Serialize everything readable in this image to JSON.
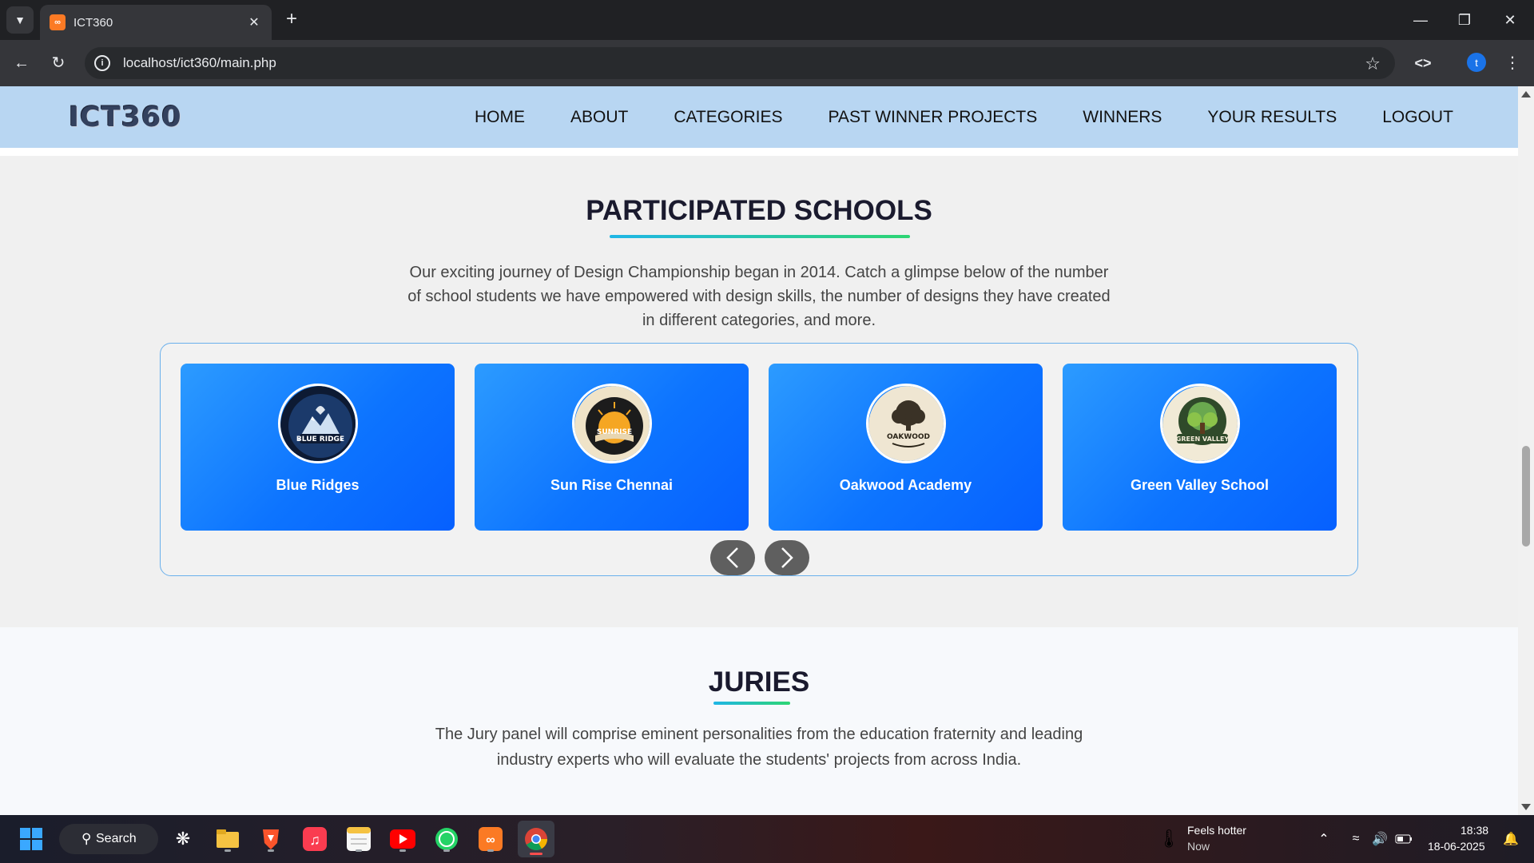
{
  "browser": {
    "tab_title": "ICT360",
    "url": "localhost/ict360/main.php",
    "profile_initial": "t"
  },
  "site": {
    "logo_text": "ICT360",
    "nav": [
      "HOME",
      "ABOUT",
      "CATEGORIES",
      "PAST WINNER PROJECTS",
      "WINNERS",
      "YOUR RESULTS",
      "LOGOUT"
    ]
  },
  "schools_section": {
    "title": "PARTICIPATED SCHOOLS",
    "description_lines": [
      "Our exciting journey of Design Championship began in 2014. Catch a glimpse below of the number",
      "of school students we have empowered with design skills, the number of designs they have created",
      "in different categories, and more."
    ],
    "schools": [
      {
        "name": "Blue Ridges",
        "logo_text": "BLUE RIDGE",
        "logo_icon": "mountain-eagle-crest-icon"
      },
      {
        "name": "Sun Rise Chennai",
        "logo_text": "SUNRISE",
        "logo_icon": "sunrise-book-icon"
      },
      {
        "name": "Oakwood Academy",
        "logo_text": "OAKWOOD",
        "logo_icon": "oak-tree-icon"
      },
      {
        "name": "Green Valley School",
        "logo_text": "GREEN VALLEY",
        "logo_icon": "green-tree-icon"
      }
    ]
  },
  "juries_section": {
    "title": "JURIES",
    "description_lines": [
      "The Jury panel will comprise eminent personalities from the education fraternity and leading",
      "industry experts who will evaluate the students' projects from across India."
    ]
  },
  "taskbar": {
    "search_label": "Search",
    "weather_title": "Feels hotter",
    "weather_sub": "Now",
    "time": "18:38",
    "date": "18-06-2025"
  },
  "colors": {
    "header_bg": "#b8d6f2",
    "card_gradient_start": "#2c9bff",
    "card_gradient_end": "#0660ff",
    "underline_start": "#1fb6e6",
    "underline_end": "#2ed573"
  }
}
